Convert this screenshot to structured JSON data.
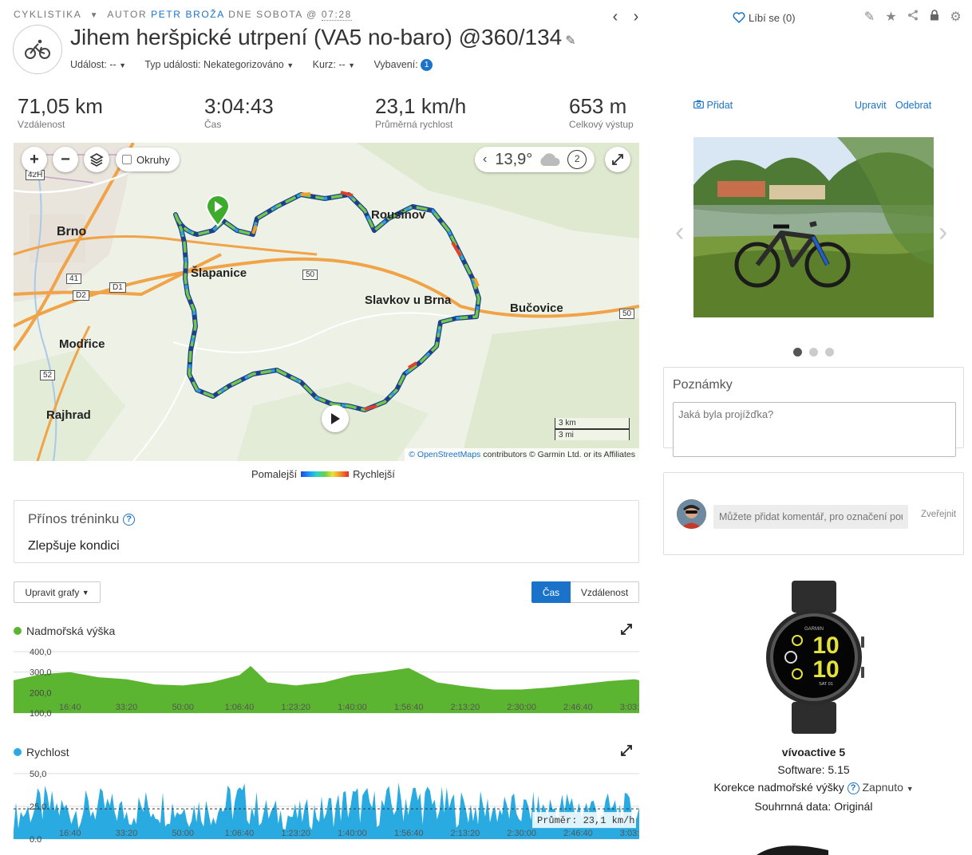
{
  "header": {
    "category": "CYKLISTIKA",
    "author_prefix": "AUTOR",
    "author": "PETR BROŽA",
    "date_prefix": "DNE SOBOTA @",
    "time": "07:28",
    "title": "Jihem heršpické utrpení (VA5 no-baro) @360/134",
    "meta": {
      "event_label": "Událost:",
      "event_value": "--",
      "type_label": "Typ události:",
      "type_value": "Nekategorizováno",
      "course_label": "Kurz:",
      "course_value": "--",
      "gear_label": "Vybavení:",
      "gear_count": "1"
    },
    "like_label": "Líbí se (0)"
  },
  "stats": [
    {
      "value": "71,05 km",
      "label": "Vzdálenost"
    },
    {
      "value": "3:04:43",
      "label": "Čas"
    },
    {
      "value": "23,1 km/h",
      "label": "Průměrná rychlost"
    },
    {
      "value": "653 m",
      "label": "Celkový výstup"
    }
  ],
  "map": {
    "okruhy_label": "Okruhy",
    "temperature": "13,9°",
    "lap_count": "2",
    "towns": {
      "brno": "Brno",
      "slapanice": "Šlapanice",
      "modrice": "Modřice",
      "rajhrad": "Rajhrad",
      "slavkov": "Slavkov u Brna",
      "bucovice": "Bučovice",
      "rousinov": "Rousínov"
    },
    "roads": {
      "r42h": "42H",
      "r41": "41",
      "d1": "D1",
      "d2": "D2",
      "r50a": "50",
      "r50b": "50",
      "r52": "52"
    },
    "scale_km": "3 km",
    "scale_mi": "3 mi",
    "attribution_link": "© OpenStreetMaps",
    "attribution_rest": " contributors © Garmin Ltd. or its Affiliates"
  },
  "speed_legend": {
    "slow": "Pomalejší",
    "fast": "Rychlejší"
  },
  "training": {
    "title": "Přínos tréninku",
    "value": "Zlepšuje kondici"
  },
  "graph_controls": {
    "edit_label": "Upravit grafy",
    "time_label": "Čas",
    "distance_label": "Vzdálenost"
  },
  "elevation_chart": {
    "title": "Nadmořská výška",
    "color": "#5cb531",
    "yticks": [
      "400,0",
      "300,0",
      "200,0",
      "100,0"
    ],
    "xticks": [
      "16:40",
      "33:20",
      "50:00",
      "1:06:40",
      "1:23:20",
      "1:40:00",
      "1:56:40",
      "2:13:20",
      "2:30:00",
      "2:46:40",
      "3:03:20"
    ]
  },
  "speed_chart": {
    "title": "Rychlost",
    "color": "#29abe2",
    "yticks": [
      "50,0",
      "25,0",
      "0,0"
    ],
    "avg_label": "Průměr: 23,1 km/h",
    "xticks": [
      "16:40",
      "33:20",
      "50:00",
      "1:06:40",
      "1:23:20",
      "1:40:00",
      "1:56:40",
      "2:13:20",
      "2:30:00",
      "2:46:40",
      "3:03:20"
    ]
  },
  "chart_data": [
    {
      "type": "area",
      "title": "Nadmořská výška",
      "xlabel": "",
      "ylabel": "",
      "ylim": [
        100,
        400
      ],
      "x": [
        "0:00",
        "8:20",
        "16:40",
        "25:00",
        "33:20",
        "41:40",
        "50:00",
        "58:20",
        "1:06:40",
        "1:10:00",
        "1:15:00",
        "1:23:20",
        "1:31:40",
        "1:40:00",
        "1:48:20",
        "1:56:40",
        "2:05:00",
        "2:13:20",
        "2:21:40",
        "2:30:00",
        "2:38:20",
        "2:46:40",
        "2:55:00",
        "3:03:20",
        "3:04:43"
      ],
      "values": [
        260,
        290,
        300,
        275,
        265,
        240,
        235,
        250,
        285,
        330,
        250,
        235,
        250,
        285,
        300,
        320,
        250,
        230,
        215,
        215,
        225,
        240,
        255,
        265,
        260
      ]
    },
    {
      "type": "area",
      "title": "Rychlost",
      "xlabel": "",
      "ylabel": "",
      "ylim": [
        0,
        50
      ],
      "average": 23.1,
      "x": [
        "0:00",
        "8:20",
        "16:40",
        "25:00",
        "33:20",
        "41:40",
        "50:00",
        "58:20",
        "1:06:40",
        "1:15:00",
        "1:23:20",
        "1:31:40",
        "1:40:00",
        "1:48:20",
        "1:56:40",
        "2:05:00",
        "2:13:20",
        "2:21:40",
        "2:30:00",
        "2:38:20",
        "2:46:40",
        "2:55:00",
        "3:03:20"
      ],
      "values": [
        18,
        26,
        22,
        25,
        21,
        27,
        24,
        23,
        30,
        20,
        18,
        22,
        28,
        24,
        32,
        26,
        24,
        23,
        22,
        24,
        25,
        23,
        22
      ]
    }
  ],
  "photo_carousel": {
    "add_label": "Přidat",
    "edit_label": "Upravit",
    "remove_label": "Odebrat"
  },
  "notes": {
    "title": "Poznámky",
    "placeholder": "Jaká byla projížďka?"
  },
  "comment": {
    "placeholder": "Můžete přidat komentář, pro označení pou",
    "publish_label": "Zveřejnit"
  },
  "watch_face": {
    "hours": "10",
    "minutes": "10",
    "brand": "GARMIN",
    "day": "SAT 01"
  },
  "device": {
    "name": "vívoactive 5",
    "software_label": "Software:",
    "software_value": "5.15",
    "altitude_label": "Korekce nadmořské výšky",
    "altitude_value": "Zapnuto",
    "summary_label": "Souhrnná data:",
    "summary_value": "Originál"
  }
}
